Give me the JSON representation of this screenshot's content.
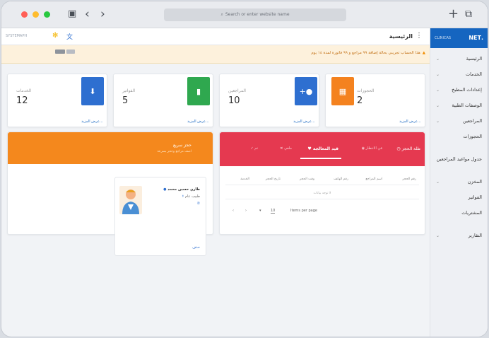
{
  "browser": {
    "address_placeholder": "Search or enter website name",
    "colors": {
      "red": "#ff5f57",
      "yellow": "#febc2e",
      "green": "#28c840"
    }
  },
  "sidebar": {
    "brand": ".NET",
    "brand_sub": "CLINICAS",
    "items": [
      {
        "label": "الرئيسية",
        "chevron": true
      },
      {
        "label": "الخدمات",
        "chevron": true
      },
      {
        "label": "إعدادات المطبخ",
        "chevron": true
      },
      {
        "label": "الوصفات الطبية",
        "chevron": true
      },
      {
        "label": "المراجعين",
        "chevron": true
      },
      {
        "label": "الحجوزات",
        "chevron": false
      },
      {
        "label": "جدول مواعيد المراجعين",
        "chevron": false
      },
      {
        "label": "المخزن",
        "chevron": true
      },
      {
        "label": "الفواتير",
        "chevron": false
      },
      {
        "label": "المشتريات",
        "chevron": false
      },
      {
        "label": "التقارير",
        "chevron": true
      }
    ]
  },
  "topbar": {
    "logo_text": "SYSTEMAPH",
    "page_title": "الرئيسية"
  },
  "banner": {
    "text": "هذا الحساب تجريبي بحالة إضافة ٩٩ مراجع و ٩٩ فاتورة لمدة ١٤ يوم"
  },
  "stats": [
    {
      "label": "الحجوزات",
      "value": "2",
      "link": "عرض المزيد...",
      "color": "#f4821f",
      "icon": "calendar-icon"
    },
    {
      "label": "المراجعين",
      "value": "10",
      "link": "عرض المزيد...",
      "color": "#2e6fd0",
      "icon": "user-plus-icon"
    },
    {
      "label": "الفواتير",
      "value": "5",
      "link": "عرض المزيد...",
      "color": "#2fa84f",
      "icon": "invoice-icon"
    },
    {
      "label": "الخدمات",
      "value": "12",
      "link": "عرض المزيد...",
      "color": "#2e6fd0",
      "icon": "download-icon"
    }
  ],
  "tabs_card": {
    "tabs": [
      {
        "label": "طلة الحجز"
      },
      {
        "label": "في الانتظار"
      },
      {
        "label": "قيد المعالجة"
      },
      {
        "label": "ملغي"
      },
      {
        "label": "تم"
      }
    ],
    "columns": [
      "رقم الحجز",
      "اسم المراجع",
      "رقم الهاتف",
      "وقت الحجز",
      "تاريخ الحجز",
      "الخدمة"
    ],
    "empty_text": "لا توجد بيانات",
    "pagination": {
      "items_label": "Items per page",
      "per_page": "10"
    }
  },
  "orange_card": {
    "title": "حجز سريع",
    "subtitle": "اضف مراجع وحجز بسرعة"
  },
  "doctor_card": {
    "name": "طاري حسين محمد",
    "role": "طبيب عام",
    "phone_icon": "phone-icon",
    "action": "حذف"
  }
}
